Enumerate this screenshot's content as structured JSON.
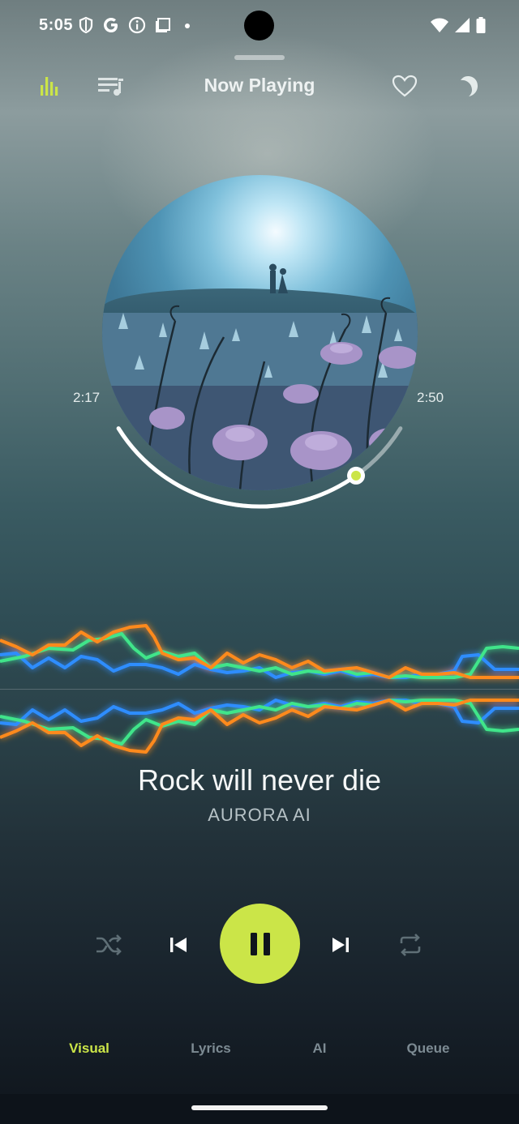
{
  "status_bar": {
    "time": "5:05",
    "icons": [
      "shield-icon",
      "google-icon",
      "info-icon",
      "screenshot-icon",
      "dot-icon"
    ],
    "right_icons": [
      "wifi-icon",
      "signal-icon",
      "battery-icon"
    ]
  },
  "topbar": {
    "title": "Now Playing",
    "left_icons": [
      "equalizer-icon",
      "playlist-icon"
    ],
    "right_icons": [
      "heart-icon",
      "moon-icon"
    ],
    "accent": "#cbe548"
  },
  "player": {
    "elapsed": "2:17",
    "duration": "2:50",
    "progress_fraction": 0.806,
    "song_title": "Rock will never die",
    "artist": "AURORA AI"
  },
  "controls": [
    "shuffle-icon",
    "previous-icon",
    "pause-icon",
    "next-icon",
    "repeat-icon"
  ],
  "tabs": [
    {
      "label": "Visual",
      "active": true
    },
    {
      "label": "Lyrics",
      "active": false
    },
    {
      "label": "AI",
      "active": false
    },
    {
      "label": "Queue",
      "active": false
    }
  ],
  "colors": {
    "accent": "#cbe548",
    "wave_orange": "#ff8a1f",
    "wave_green": "#3fe58a",
    "wave_blue": "#2f8dff"
  }
}
